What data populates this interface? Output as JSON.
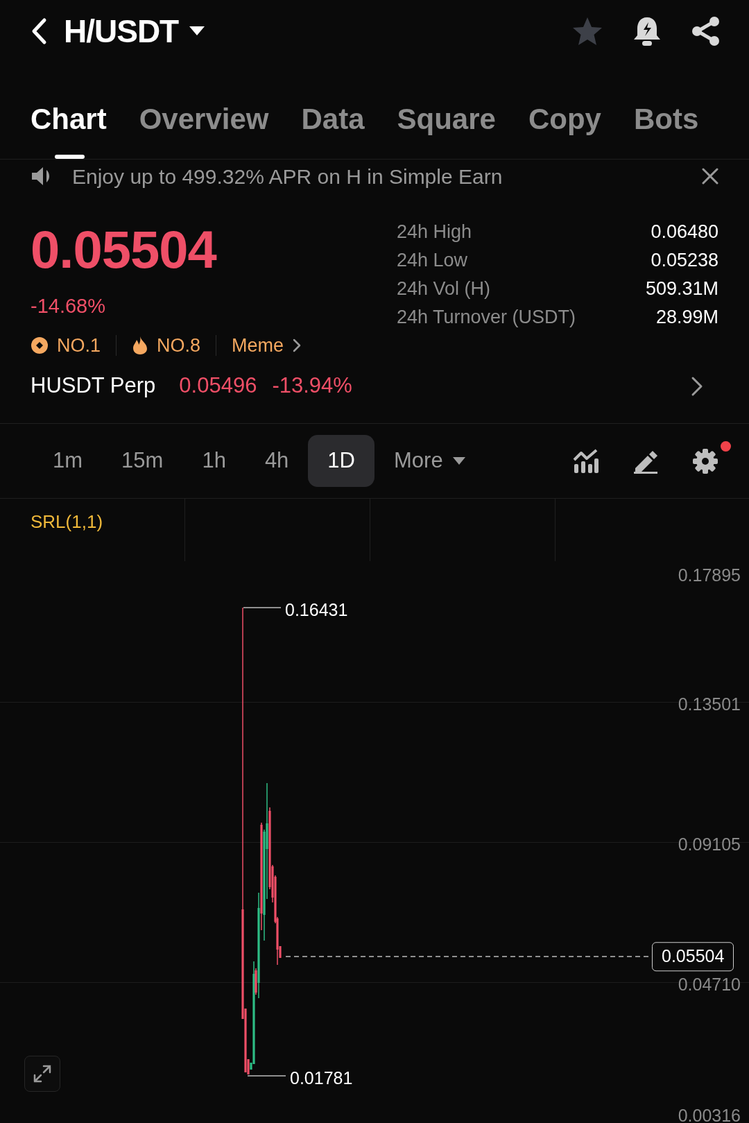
{
  "header": {
    "title": "H/USDT",
    "favorite": false
  },
  "tabs": [
    {
      "label": "Chart",
      "selected": true
    },
    {
      "label": "Overview",
      "selected": false
    },
    {
      "label": "Data",
      "selected": false
    },
    {
      "label": "Square",
      "selected": false
    },
    {
      "label": "Copy",
      "selected": false
    },
    {
      "label": "Bots",
      "selected": false
    }
  ],
  "announcement": {
    "text": "Enjoy up to 499.32% APR on H in Simple Earn"
  },
  "price": {
    "last": "0.05504",
    "change": "-14.68%"
  },
  "tags": [
    {
      "kind": "rank_coin",
      "label": "NO.1"
    },
    {
      "kind": "rank_hot",
      "label": "NO.8"
    },
    {
      "kind": "category",
      "label": "Meme"
    }
  ],
  "stats": [
    {
      "label": "24h High",
      "value": "0.06480"
    },
    {
      "label": "24h Low",
      "value": "0.05238"
    },
    {
      "label": "24h Vol (H)",
      "value": "509.31M"
    },
    {
      "label": "24h Turnover (USDT)",
      "value": "28.99M"
    }
  ],
  "perp": {
    "name": "HUSDT Perp",
    "price": "0.05496",
    "change": "-13.94%"
  },
  "timeframes": [
    {
      "label": "1m",
      "selected": false
    },
    {
      "label": "15m",
      "selected": false
    },
    {
      "label": "1h",
      "selected": false
    },
    {
      "label": "4h",
      "selected": false
    },
    {
      "label": "1D",
      "selected": true
    },
    {
      "label": "More",
      "selected": false
    }
  ],
  "settings_alert": true,
  "chart": {
    "indicator": "SRL(1,1)",
    "y_axis_labels": [
      "0.17895",
      "0.13501",
      "0.09105",
      "0.04710",
      "0.00316"
    ],
    "high_label": "0.16431",
    "low_label": "0.01781",
    "last_price_label": "0.05504"
  }
}
